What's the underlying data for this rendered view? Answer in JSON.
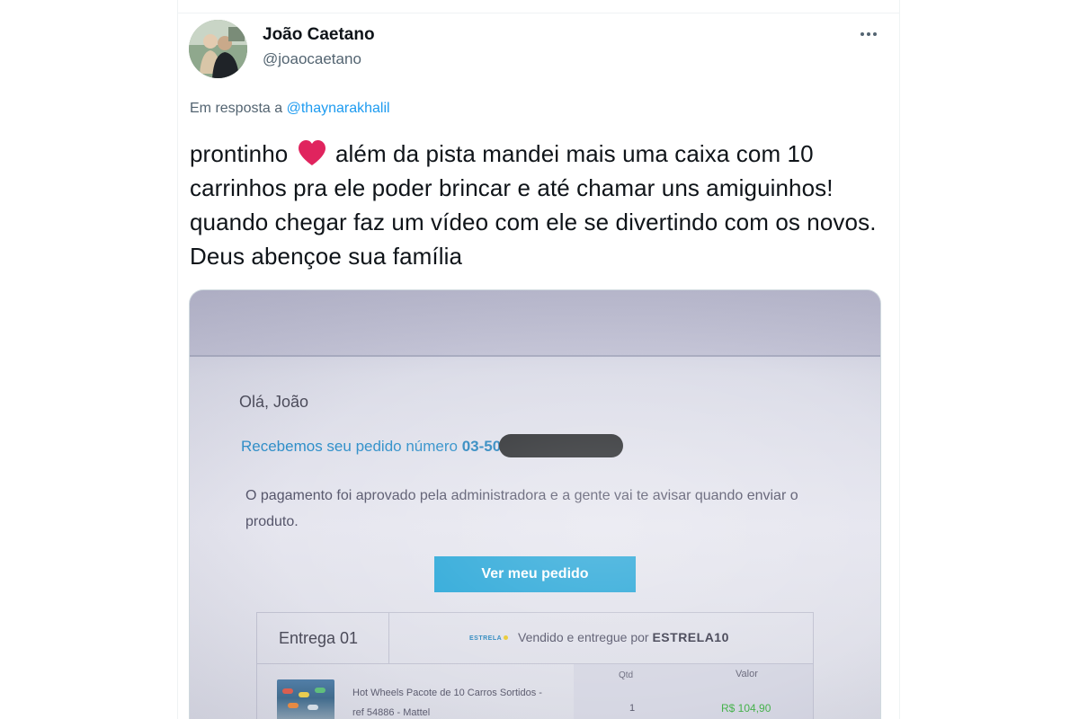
{
  "tweet": {
    "author_name": "João Caetano",
    "author_handle": "@joaocaetano",
    "reply_prefix": "Em resposta a",
    "reply_mention": "@thaynarakhalil",
    "text_before_emoji": "prontinho",
    "emoji": "heart-emoji",
    "text_after_emoji": "além da pista mandei mais uma caixa com 10 carrinhos pra ele poder brincar e até chamar uns amiguinhos! quando chegar faz um vídeo com ele se divertindo com os novos. Deus abençoe sua família",
    "more_icon": "more-icon"
  },
  "photo": {
    "greeting": "Olá, João",
    "order_text": "Recebemos seu pedido número",
    "order_number_visible": "03-50",
    "message": "O pagamento foi aprovado pela administradora e a gente vai te avisar quando enviar o produto.",
    "button_label": "Ver meu pedido",
    "delivery_label": "Entrega 01",
    "seller_logo_text": "ESTRELA",
    "seller_prefix": "Vendido e entregue por",
    "seller_name": "ESTRELA10",
    "product_name": "Hot Wheels Pacote de 10 Carros Sortidos - ref 54886 - Mattel",
    "qty_header": "Qtd",
    "value_header": "Valor",
    "qty": "1",
    "price": "R$ 104,90"
  },
  "colors": {
    "link": "#1d9bf0",
    "text_primary": "#0f1419",
    "text_secondary": "#536471",
    "heart": "#e0245e",
    "cta": "#29a7d8"
  }
}
